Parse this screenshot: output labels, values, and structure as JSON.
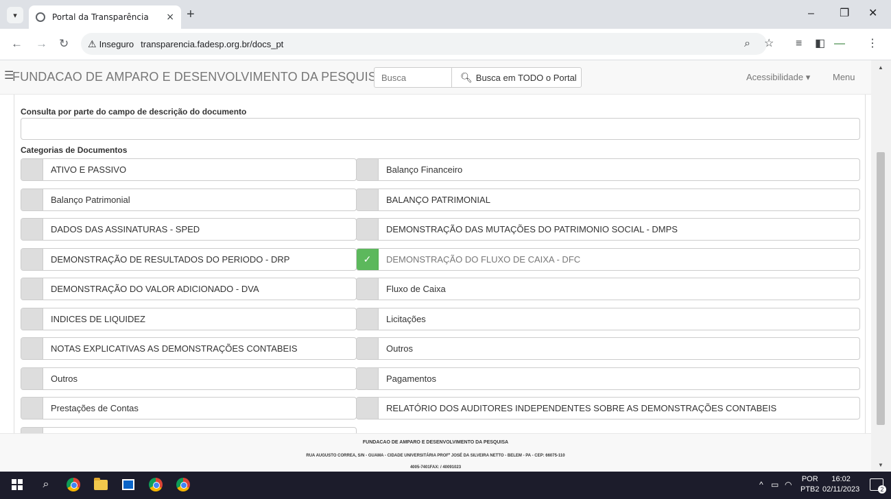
{
  "browser": {
    "tab_title": "Portal da Transparência",
    "tab_close": "×",
    "new_tab": "+",
    "insecure_label": "Inseguro",
    "url": "transparencia.fadesp.org.br/docs_pt",
    "minimize": "–",
    "restore": "❐",
    "close": "✕"
  },
  "site": {
    "brand": "FUNDACAO DE AMPARO E DESENVOLVIMENTO DA PESQUISA",
    "search_placeholder": "Busca",
    "search_button": "Busca em TODO o Portal",
    "accessibility": "Acessibilidade ▾",
    "menu": "Menu"
  },
  "form": {
    "description_label": "Consulta por parte do campo de descrição do documento",
    "description_value": "",
    "categories_label": "Categorias de Documentos"
  },
  "categories": [
    {
      "label": "ATIVO E PASSIVO",
      "checked": false
    },
    {
      "label": "Balanço Financeiro",
      "checked": false
    },
    {
      "label": "Balanço Patrimonial",
      "checked": false
    },
    {
      "label": "BALANÇO PATRIMONIAL",
      "checked": false
    },
    {
      "label": "DADOS DAS ASSINATURAS - SPED",
      "checked": false
    },
    {
      "label": "DEMONSTRAÇÃO DAS MUTAÇÕES DO PATRIMONIO SOCIAL - DMPS",
      "checked": false
    },
    {
      "label": "DEMONSTRAÇÃO DE RESULTADOS DO PERIODO - DRP",
      "checked": false
    },
    {
      "label": "DEMONSTRAÇÃO DO FLUXO DE CAIXA - DFC",
      "checked": true
    },
    {
      "label": "DEMONSTRAÇÃO DO VALOR ADICIONADO - DVA",
      "checked": false
    },
    {
      "label": "Fluxo de Caixa",
      "checked": false
    },
    {
      "label": "INDICES DE LIQUIDEZ",
      "checked": false
    },
    {
      "label": "Licitações",
      "checked": false
    },
    {
      "label": "NOTAS EXPLICATIVAS AS DEMONSTRAÇÕES CONTABEIS",
      "checked": false
    },
    {
      "label": "Outros",
      "checked": false
    },
    {
      "label": "Outros",
      "checked": false
    },
    {
      "label": "Pagamentos",
      "checked": false
    },
    {
      "label": "Prestações de Contas",
      "checked": false
    },
    {
      "label": "RELATÓRIO DOS AUDITORES INDEPENDENTES SOBRE AS DEMONSTRAÇÕES CONTABEIS",
      "checked": false
    },
    {
      "label": "",
      "checked": false
    }
  ],
  "footer": {
    "line1": "FUNDACAO DE AMPARO E DESENVOLVIMENTO DA PESQUISA",
    "line2": "RUA AUGUSTO CORREA, S/N - GUAMA - CIDADE UNIVERSITÁRIA PROFº JOSÉ DA SILVEIRA NETTO - BELEM - PA - CEP: 66075-110",
    "line3": "4005-7401FAX: / 40091023"
  },
  "taskbar": {
    "lang_top": "POR",
    "lang_bottom": "PTB2",
    "time": "16:02",
    "date": "02/11/2023",
    "notification_count": "2"
  },
  "icons": [
    "tab-list-icon",
    "globe-icon",
    "back-icon",
    "forward-icon",
    "reload-icon",
    "warning-icon",
    "zoom-icon",
    "star-icon",
    "reading-list-icon",
    "side-panel-icon",
    "extension-icon",
    "more-icon",
    "hamburger-icon",
    "search-icon",
    "check-icon",
    "windows-icon",
    "taskbar-search-icon",
    "chrome-icon",
    "file-explorer-icon",
    "photos-icon"
  ],
  "colors": {
    "checked_green": "#5cb85c",
    "header_bg": "#f8f8f8",
    "taskbar_bg": "#1c1c2b"
  }
}
